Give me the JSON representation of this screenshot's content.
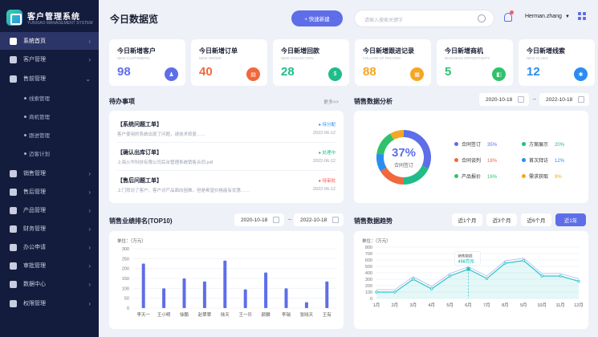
{
  "app": {
    "title": "客户管理系统",
    "subtitle": "YUNXIAO MANAGEMENT SYSTEM"
  },
  "sidebar": {
    "items": [
      {
        "label": "系统首页",
        "active": true,
        "icon": "home-icon"
      },
      {
        "label": "客户管理",
        "icon": "user-icon"
      },
      {
        "label": "售前管理",
        "icon": "chat-icon",
        "expanded": true
      },
      {
        "label": "销售管理",
        "icon": "sales-icon"
      },
      {
        "label": "售后管理",
        "icon": "service-icon"
      },
      {
        "label": "产品管理",
        "icon": "product-icon"
      },
      {
        "label": "财务管理",
        "icon": "finance-icon"
      },
      {
        "label": "办公申请",
        "icon": "office-icon"
      },
      {
        "label": "审批管理",
        "icon": "approval-icon"
      },
      {
        "label": "数据中心",
        "icon": "data-icon"
      },
      {
        "label": "权限管理",
        "icon": "shield-icon"
      }
    ],
    "subitems": [
      "线索管理",
      "商机管理",
      "跟进管理",
      "迈客计划"
    ]
  },
  "header": {
    "page_title": "今日数据览",
    "quick_new": "+ 快速新建",
    "search_placeholder": "请输入搜索关键字",
    "user_name": "Herman.zhang"
  },
  "stats": [
    {
      "title": "今日新增客户",
      "sub": "NEW CUSTOMERS",
      "value": "98",
      "color": "#5e6ee8"
    },
    {
      "title": "今日新增订单",
      "sub": "NEW ORDER",
      "value": "40",
      "color": "#f0683c"
    },
    {
      "title": "今日新增回款",
      "sub": "NEW COLLECTION",
      "value": "28",
      "color": "#20bc8a"
    },
    {
      "title": "今日新增跟进记录",
      "sub": "FOLLOW UP RECORD",
      "value": "88",
      "color": "#f5a623"
    },
    {
      "title": "今日新增商机",
      "sub": "BUSINESS OPPORTUNITY",
      "value": "5",
      "color": "#2fc26b"
    },
    {
      "title": "今日新增线索",
      "sub": "NEW CLUES",
      "value": "12",
      "color": "#2b8df0"
    }
  ],
  "todo": {
    "title": "待办事项",
    "more": "更多>>",
    "items": [
      {
        "title": "【系统问题工单】",
        "desc": "客户使用的系统出现了问题，请技术修复……",
        "status": "● 待分配",
        "status_color": "#2b8df0",
        "date": "2022-06-12"
      },
      {
        "title": "【确认出库订单】",
        "desc": "上海火华科技有限公司后台管理系统销售合同.pdf",
        "status": "● 处理中",
        "status_color": "#20bc8a",
        "date": "2022-06-12"
      },
      {
        "title": "【售后问题工单】",
        "desc": "上门拜访了客户，客户对产品面向困难，但是希望价格能有优惠……",
        "status": "● 待审批",
        "status_color": "#ff4d4f",
        "date": "2022-06-12"
      }
    ]
  },
  "analysis": {
    "title": "销售数据分析",
    "date_from": "2020-10-18",
    "date_to": "2022-10-18",
    "center_value": "37%",
    "center_label": "合同签订",
    "legend": [
      {
        "name": "合同签订",
        "pct": "35%",
        "color": "#5e6ee8"
      },
      {
        "name": "方案展示",
        "pct": "20%",
        "color": "#20bc8a"
      },
      {
        "name": "合同谈判",
        "pct": "18%",
        "color": "#f0683c"
      },
      {
        "name": "首次拜访",
        "pct": "12%",
        "color": "#2b8df0"
      },
      {
        "name": "产品报价",
        "pct": "16%",
        "color": "#2fc26b"
      },
      {
        "name": "需求获取",
        "pct": "9%",
        "color": "#f5a623"
      }
    ]
  },
  "ranking": {
    "title": "销售业绩排名(TOP10)",
    "date_from": "2020-10-18",
    "date_to": "2022-10-18",
    "unit": "单位：（万元）"
  },
  "trend": {
    "title": "销售数据趋势",
    "periods": [
      "近1个月",
      "近3个月",
      "近6个月",
      "近1年"
    ],
    "active_period": 3,
    "unit": "单位：（万元）",
    "tooltip_label": "销售数据",
    "tooltip_value": "458万元"
  },
  "chart_data": [
    {
      "type": "bar",
      "categories": [
        "李天一",
        "王小明",
        "徐鹏",
        "赵翠翠",
        "徐天",
        "王一乐",
        "颜麟",
        "李瑞",
        "张晓天",
        "王有"
      ],
      "values": [
        225,
        100,
        150,
        135,
        240,
        95,
        180,
        100,
        30,
        135
      ],
      "ylabel": "单位：（万元）",
      "ylim": [
        0,
        300
      ],
      "yticks": [
        0,
        50,
        100,
        150,
        200,
        250,
        300
      ],
      "color": "#5e6ee8"
    },
    {
      "type": "line",
      "x": [
        "1月",
        "2月",
        "3月",
        "4月",
        "5月",
        "6月",
        "7月",
        "8月",
        "9月",
        "10月",
        "11月",
        "12月"
      ],
      "values": [
        100,
        100,
        300,
        150,
        350,
        458,
        310,
        550,
        590,
        350,
        350,
        270
      ],
      "ylabel": "单位：（万元）",
      "ylim": [
        0,
        800
      ],
      "yticks": [
        0,
        100,
        200,
        300,
        400,
        500,
        600,
        700,
        800
      ],
      "highlight_index": 5,
      "color": "#29c6c6"
    }
  ]
}
